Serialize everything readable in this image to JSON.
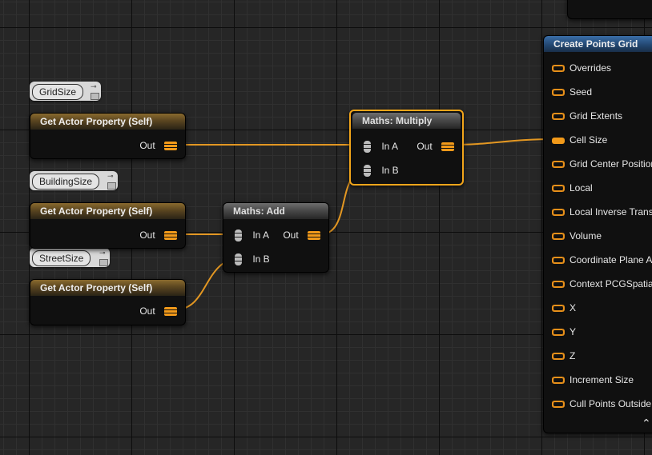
{
  "comments": [
    {
      "id": "gridsize",
      "text": "GridSize"
    },
    {
      "id": "buildingsize",
      "text": "BuildingSize"
    },
    {
      "id": "streetsize",
      "text": "StreetSize"
    }
  ],
  "nodes": {
    "get_prop_1": {
      "title": "Get Actor Property (Self)",
      "out_label": "Out"
    },
    "get_prop_2": {
      "title": "Get Actor Property (Self)",
      "out_label": "Out"
    },
    "get_prop_3": {
      "title": "Get Actor Property (Self)",
      "out_label": "Out"
    },
    "add": {
      "title": "Maths: Add",
      "in_a": "In A",
      "in_b": "In B",
      "out_label": "Out"
    },
    "multiply": {
      "title": "Maths: Multiply",
      "in_a": "In A",
      "in_b": "In B",
      "out_label": "Out"
    },
    "grid": {
      "title": "Create Points Grid",
      "pins": [
        "Overrides",
        "Seed",
        "Grid Extents",
        "Cell Size",
        "Grid Center Position",
        "Local",
        "Local Inverse Transform",
        "Volume",
        "Coordinate Plane Axis",
        "Context PCGSpatial",
        "X",
        "Y",
        "Z",
        "Increment Size",
        "Cull Points Outside"
      ],
      "collapse_glyph": "⌃"
    }
  },
  "glyphs": {
    "pin_icon": "⊸",
    "dock_icon": "dock-icon"
  },
  "colors": {
    "wire": "#e39722",
    "pin_orange": "#f29a1a",
    "selected_border": "#f2a51a",
    "grid_header": "#2d5a8c"
  }
}
